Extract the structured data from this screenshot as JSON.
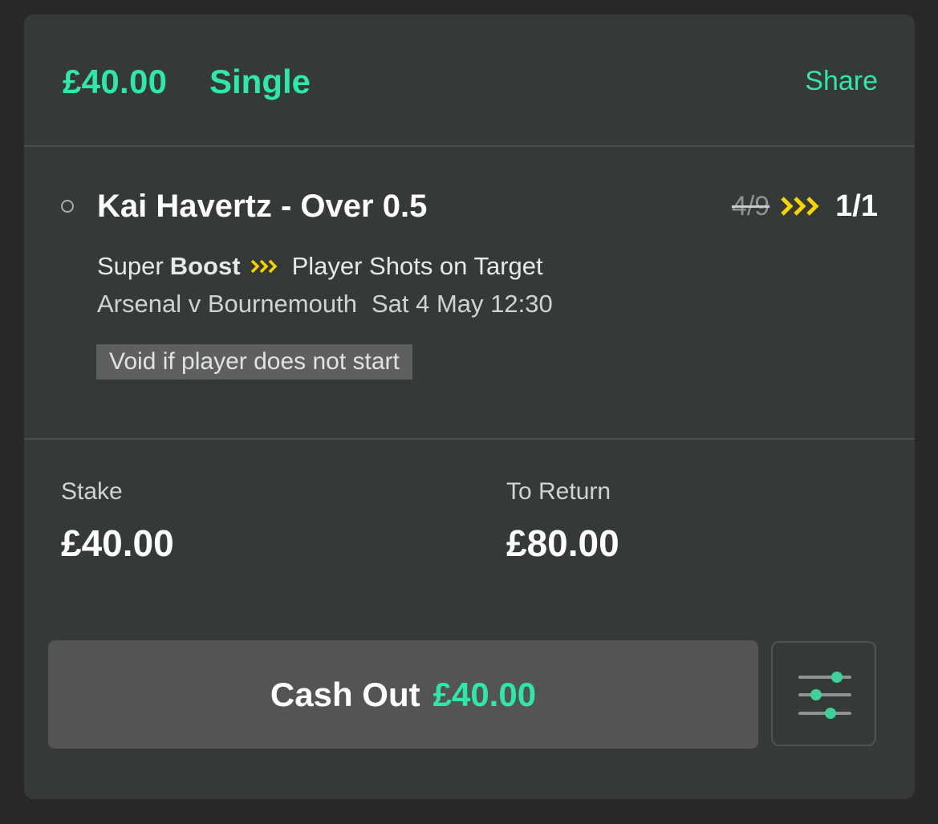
{
  "header": {
    "amount": "£40.00",
    "bet_type": "Single",
    "share_label": "Share"
  },
  "selection": {
    "name": "Kai Havertz - Over 0.5",
    "old_odds": "4/9",
    "new_odds": "1/1",
    "super_label": "Super",
    "boost_label": "Boost",
    "market": "Player Shots on Target",
    "event": "Arsenal v Bournemouth",
    "event_time": "Sat 4 May 12:30",
    "void_note": "Void if player does not start"
  },
  "stake": {
    "label": "Stake",
    "value": "£40.00"
  },
  "to_return": {
    "label": "To Return",
    "value": "£80.00"
  },
  "cashout": {
    "label": "Cash Out",
    "amount": "£40.00"
  },
  "colors": {
    "accent": "#2ee8a8",
    "boost": "#f5d400",
    "card_bg": "#353937",
    "page_bg": "#272827",
    "button_bg": "#545454"
  },
  "icons": {
    "boost": "chevrons-right-icon",
    "settings": "sliders-icon",
    "radio": "radio-circle-icon"
  }
}
